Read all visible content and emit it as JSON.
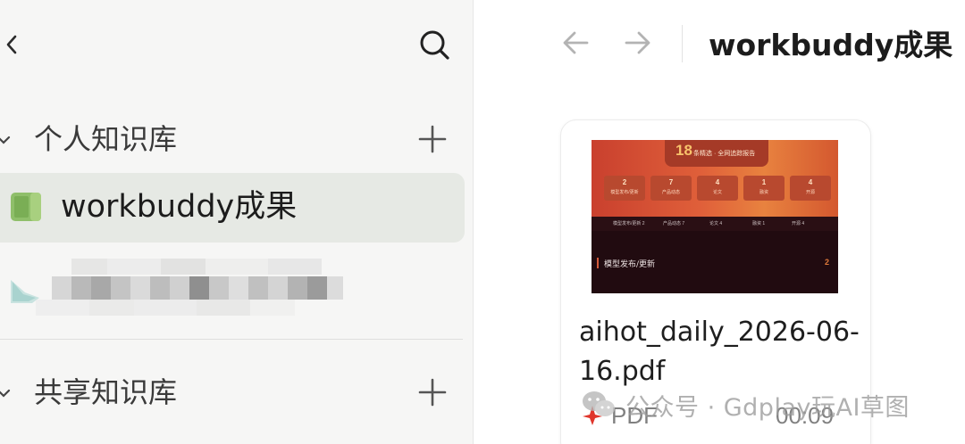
{
  "sidebar": {
    "sections": [
      {
        "title": "个人知识库"
      },
      {
        "title": "共享知识库"
      }
    ],
    "items": [
      {
        "label": "workbuddy成果",
        "selected": true
      },
      {
        "label": ""
      }
    ]
  },
  "main": {
    "title": "workbuddy成果",
    "file": {
      "name": "aihot_daily_2026-06-16.pdf",
      "type": "PDF",
      "time": "00:09",
      "thumbnail": {
        "headline_number": "18",
        "headline_text": "条精选 · 全网追踪报告",
        "stats": [
          {
            "value": "2",
            "label": "模型发布/更新"
          },
          {
            "value": "7",
            "label": "产品动态"
          },
          {
            "value": "4",
            "label": "论文"
          },
          {
            "value": "1",
            "label": "融资"
          },
          {
            "value": "4",
            "label": "开源"
          }
        ],
        "bar_items": [
          "模型发布/更新 2",
          "产品动态 7",
          "论文 4",
          "融资 1",
          "开源 4"
        ],
        "section_title": "模型发布/更新",
        "section_count": "2"
      }
    }
  },
  "watermark": {
    "text": "公众号 · Gdplay玩AI草图"
  },
  "colors": {
    "sidebar_bg": "#f6f6f5",
    "selected_bg": "#e6e9e4",
    "book_icon": "#8fbf6a",
    "pdf_red": "#e0362c"
  }
}
